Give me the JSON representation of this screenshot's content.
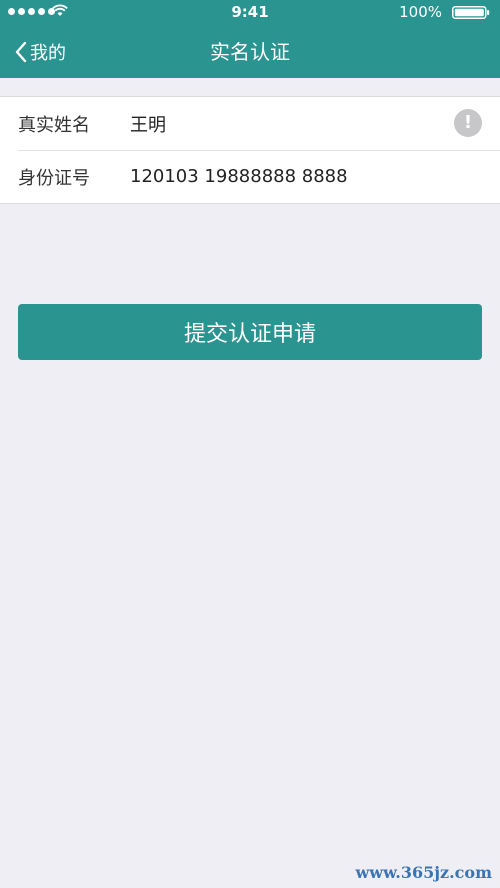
{
  "status_bar": {
    "time": "9:41",
    "battery_percent": "100%",
    "signal_icon": "signal-dots-icon",
    "wifi_icon": "wifi-icon",
    "battery_icon": "battery-icon"
  },
  "nav": {
    "back_label": "我的",
    "back_icon": "chevron-left-icon",
    "title": "实名认证"
  },
  "form": {
    "name_label": "真实姓名",
    "name_value": "王明",
    "name_info_icon": "exclamation-icon",
    "id_label": "身份证号",
    "id_value": "120103 19888888 8888"
  },
  "submit_label": "提交认证申请",
  "watermark": "www.365jz.com",
  "colors": {
    "brand": "#2a9490",
    "background": "#efeef4",
    "info_icon": "#c7c7c9"
  }
}
